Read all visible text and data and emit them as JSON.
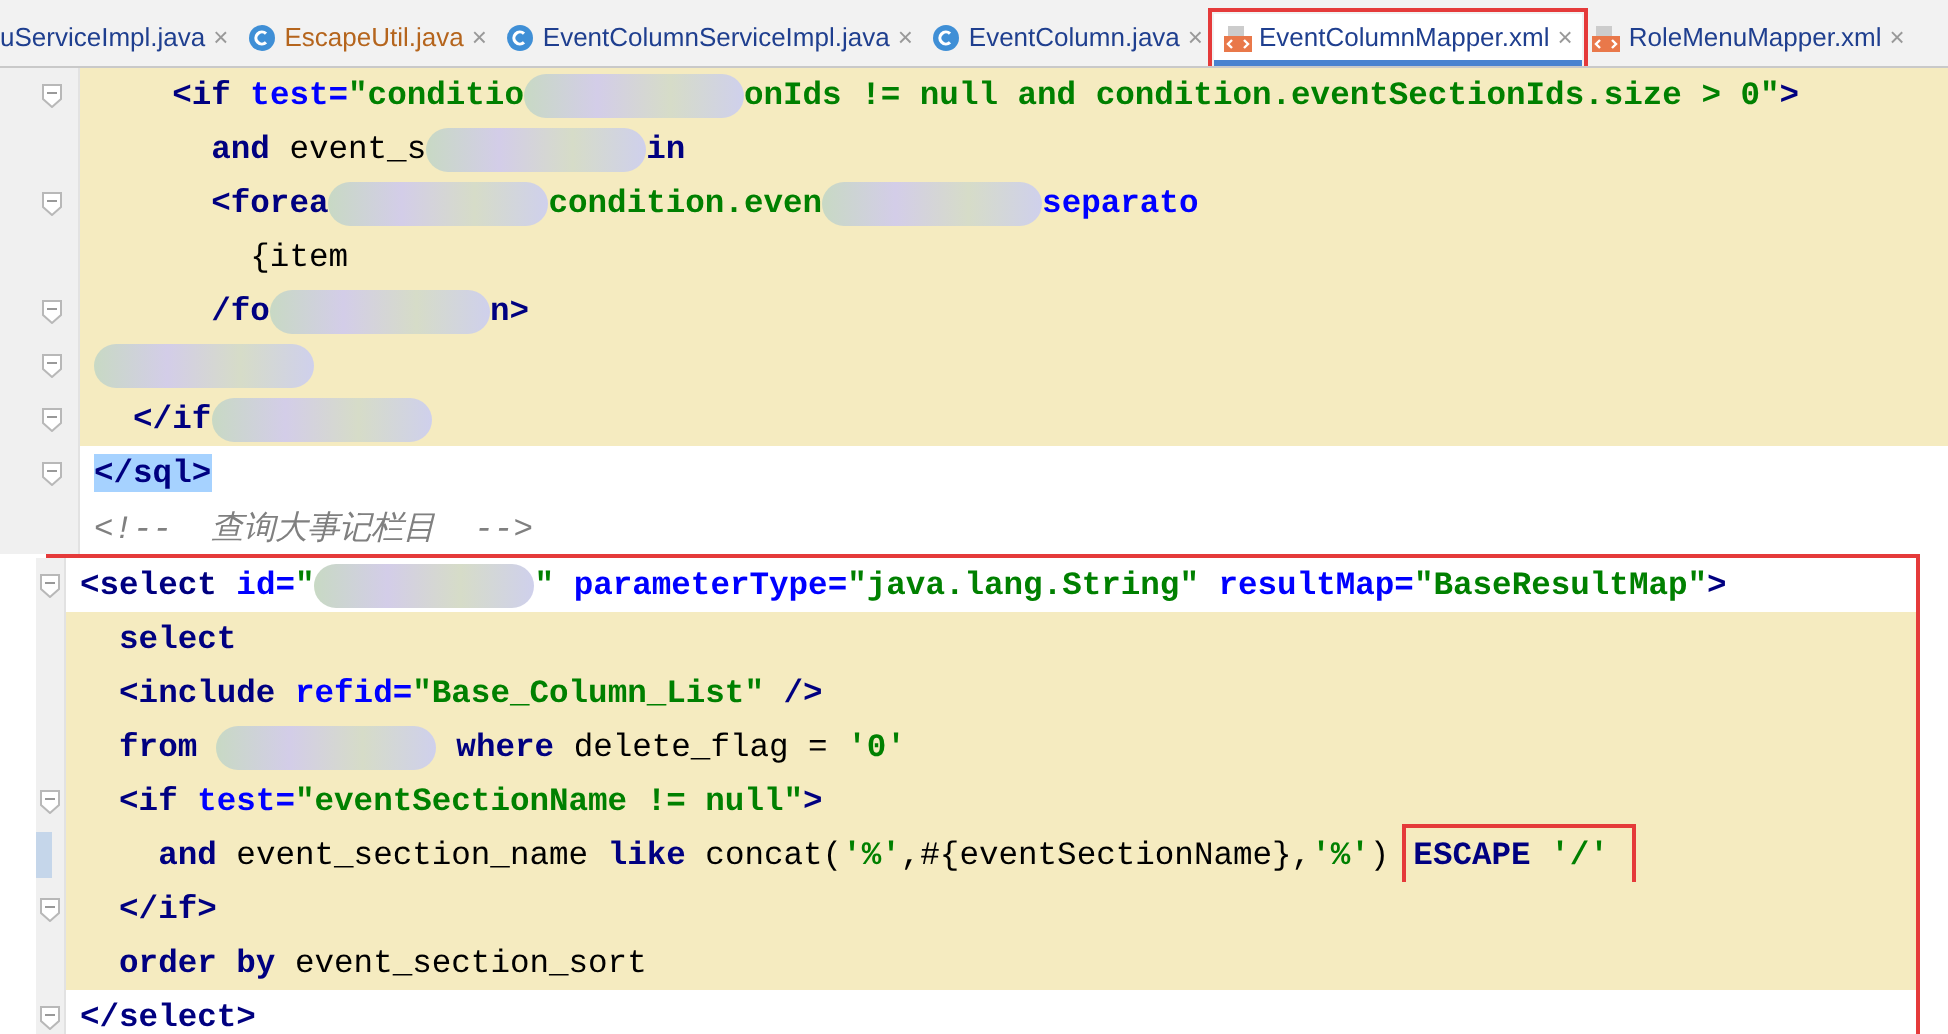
{
  "tabs": [
    {
      "label": "uServiceImpl.java",
      "kind": "cut",
      "close": "×",
      "modified": false,
      "selected": false,
      "annotated": false
    },
    {
      "label": "EscapeUtil.java",
      "kind": "java",
      "close": "×",
      "modified": true,
      "selected": false,
      "annotated": false
    },
    {
      "label": "EventColumnServiceImpl.java",
      "kind": "java",
      "close": "×",
      "modified": false,
      "selected": false,
      "annotated": false
    },
    {
      "label": "EventColumn.java",
      "kind": "java",
      "close": "×",
      "modified": false,
      "selected": false,
      "annotated": false
    },
    {
      "label": "EventColumnMapper.xml",
      "kind": "xml",
      "close": "×",
      "modified": false,
      "selected": true,
      "annotated": true
    },
    {
      "label": "RoleMenuMapper.xml",
      "kind": "xml",
      "close": "×",
      "modified": false,
      "selected": false,
      "annotated": false
    }
  ],
  "editor": {
    "lines": [
      {
        "highlighted": true,
        "fold": true,
        "tokens": [
          {
            "kind": "tag",
            "text": "    <if "
          },
          {
            "kind": "attr",
            "text": "test="
          },
          {
            "kind": "str",
            "text": "\"conditio"
          },
          {
            "kind": "redacted"
          },
          {
            "kind": "str",
            "text": "onIds != null and condition.eventSectionIds.size > 0\""
          },
          {
            "kind": "tag",
            "text": ">"
          }
        ]
      },
      {
        "highlighted": true,
        "fold": false,
        "tokens": [
          {
            "kind": "kw",
            "text": "      and"
          },
          {
            "kind": "plain",
            "text": " event_s"
          },
          {
            "kind": "redacted"
          },
          {
            "kind": "kw",
            "text": "in"
          }
        ]
      },
      {
        "highlighted": true,
        "fold": true,
        "tokens": [
          {
            "kind": "tag",
            "text": "      <forea"
          },
          {
            "kind": "redacted"
          },
          {
            "kind": "str",
            "text": "condition.even"
          },
          {
            "kind": "redacted"
          },
          {
            "kind": "attr",
            "text": "separato"
          }
        ]
      },
      {
        "highlighted": true,
        "fold": false,
        "tokens": [
          {
            "kind": "plain",
            "text": "        {item"
          }
        ]
      },
      {
        "highlighted": true,
        "fold": true,
        "tokens": [
          {
            "kind": "tag",
            "text": "      /fo"
          },
          {
            "kind": "redacted"
          },
          {
            "kind": "tag",
            "text": "n>"
          }
        ]
      },
      {
        "highlighted": true,
        "fold": true,
        "tokens": [
          {
            "kind": "redacted"
          }
        ]
      },
      {
        "highlighted": true,
        "fold": true,
        "tokens": [
          {
            "kind": "tag",
            "text": "  </if"
          },
          {
            "kind": "redacted"
          }
        ]
      },
      {
        "highlighted": false,
        "fold": true,
        "tokens": [
          {
            "kind": "sel",
            "text": "</sql>"
          }
        ]
      },
      {
        "highlighted": false,
        "fold": false,
        "tokens": [
          {
            "kind": "comment",
            "text": "<!--  查询大事记栏目  -->"
          }
        ]
      }
    ],
    "framed_lines": [
      {
        "highlighted": false,
        "fold": true,
        "tokens": [
          {
            "kind": "tag",
            "text": "<select "
          },
          {
            "kind": "attr",
            "text": "id="
          },
          {
            "kind": "str",
            "text": "\""
          },
          {
            "kind": "redacted"
          },
          {
            "kind": "str",
            "text": "\" "
          },
          {
            "kind": "attr",
            "text": "parameterType="
          },
          {
            "kind": "str",
            "text": "\"java.lang.String\" "
          },
          {
            "kind": "attr",
            "text": "resultMap="
          },
          {
            "kind": "str",
            "text": "\"BaseResultMap\""
          },
          {
            "kind": "tag",
            "text": ">"
          }
        ]
      },
      {
        "highlighted": true,
        "fold": false,
        "tokens": [
          {
            "kind": "kw",
            "text": "  select"
          }
        ]
      },
      {
        "highlighted": true,
        "fold": false,
        "tokens": [
          {
            "kind": "tag",
            "text": "  <include "
          },
          {
            "kind": "attr",
            "text": "refid="
          },
          {
            "kind": "str",
            "text": "\"Base_Column_List\" "
          },
          {
            "kind": "tag",
            "text": "/>"
          }
        ]
      },
      {
        "highlighted": true,
        "fold": false,
        "tokens": [
          {
            "kind": "kw",
            "text": "  from "
          },
          {
            "kind": "redacted"
          },
          {
            "kind": "kw",
            "text": " where "
          },
          {
            "kind": "plain",
            "text": "delete_flag = "
          },
          {
            "kind": "str",
            "text": "'0'"
          }
        ]
      },
      {
        "highlighted": true,
        "fold": true,
        "tokens": [
          {
            "kind": "tag",
            "text": "  <if "
          },
          {
            "kind": "attr",
            "text": "test="
          },
          {
            "kind": "str",
            "text": "\"eventSectionName != null\""
          },
          {
            "kind": "tag",
            "text": ">"
          }
        ]
      },
      {
        "highlighted": true,
        "fold": false,
        "changed": true,
        "tokens": [
          {
            "kind": "kw",
            "text": "    and "
          },
          {
            "kind": "plain",
            "text": "event_section_name "
          },
          {
            "kind": "kw",
            "text": "like "
          },
          {
            "kind": "plain",
            "text": "concat("
          },
          {
            "kind": "str",
            "text": "'%'"
          },
          {
            "kind": "plain",
            "text": ",#{eventSectionName},"
          },
          {
            "kind": "str",
            "text": "'%'"
          },
          {
            "kind": "plain",
            "text": ")"
          },
          {
            "kind": "frame",
            "tokens": [
              {
                "kind": "kw",
                "text": "ESCAPE "
              },
              {
                "kind": "str",
                "text": "'/'"
              }
            ]
          }
        ]
      },
      {
        "highlighted": true,
        "fold": true,
        "tokens": [
          {
            "kind": "tag",
            "text": "  </if>"
          }
        ]
      },
      {
        "highlighted": true,
        "fold": false,
        "tokens": [
          {
            "kind": "kw",
            "text": "  order by "
          },
          {
            "kind": "plain",
            "text": "event_section_sort"
          }
        ]
      },
      {
        "highlighted": false,
        "fold": true,
        "tokens": [
          {
            "kind": "tag",
            "text": "</select>"
          }
        ]
      }
    ]
  }
}
